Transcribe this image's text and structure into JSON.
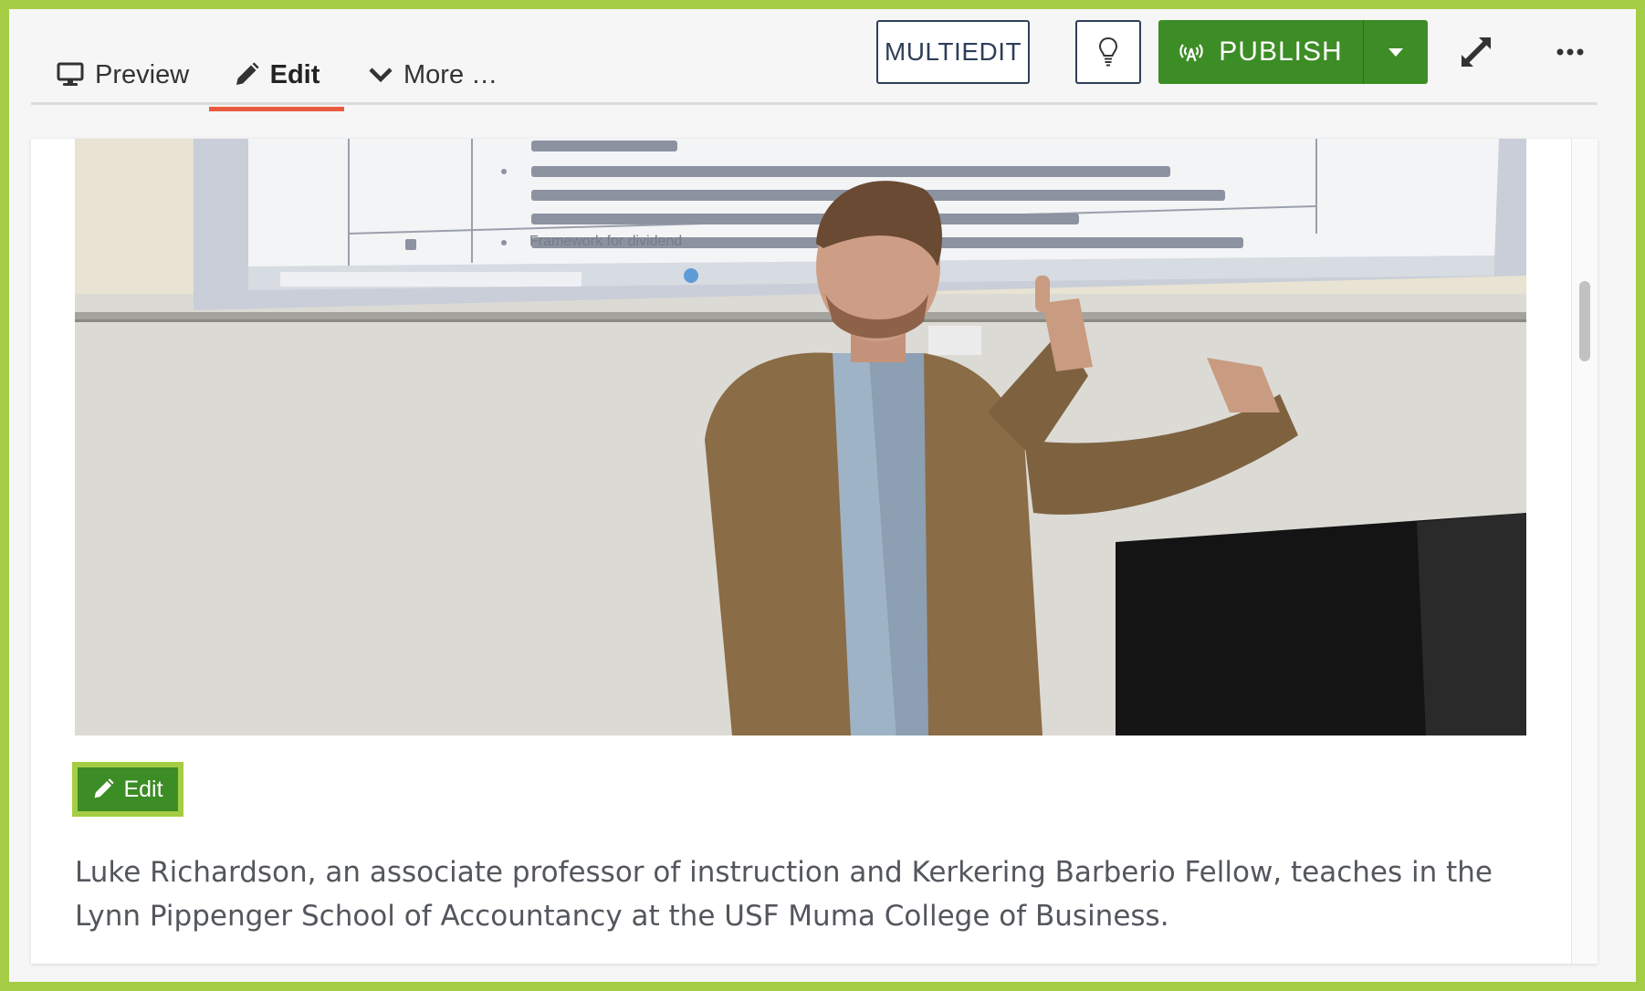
{
  "toolbar": {
    "tabs": {
      "preview": "Preview",
      "edit": "Edit",
      "more": "More …"
    },
    "multiedit_label": "MULTIEDIT",
    "publish_label": "PUBLISH",
    "colors": {
      "frame_accent": "#a4cd45",
      "publish_green": "#3c8d25",
      "active_tab_underline": "#ea5a3f",
      "outline_button_border": "#2e3f58"
    },
    "icons": {
      "preview": "monitor-icon",
      "edit": "pencil-icon",
      "more": "chevron-down-icon",
      "idea": "lightbulb-icon",
      "publish": "broadcast-icon",
      "publish_menu": "caret-down-icon",
      "expand": "expand-arrows-icon",
      "overflow": "ellipsis-icon"
    }
  },
  "content": {
    "image_slide": "Framework for dividend",
    "image_edit_label": "Edit",
    "caption": "Luke Richardson, an associate professor of instruction and Kerkering Barberio Fellow, teaches in the Lynn Pippenger School of Accountancy at the USF Muma College of Business."
  }
}
